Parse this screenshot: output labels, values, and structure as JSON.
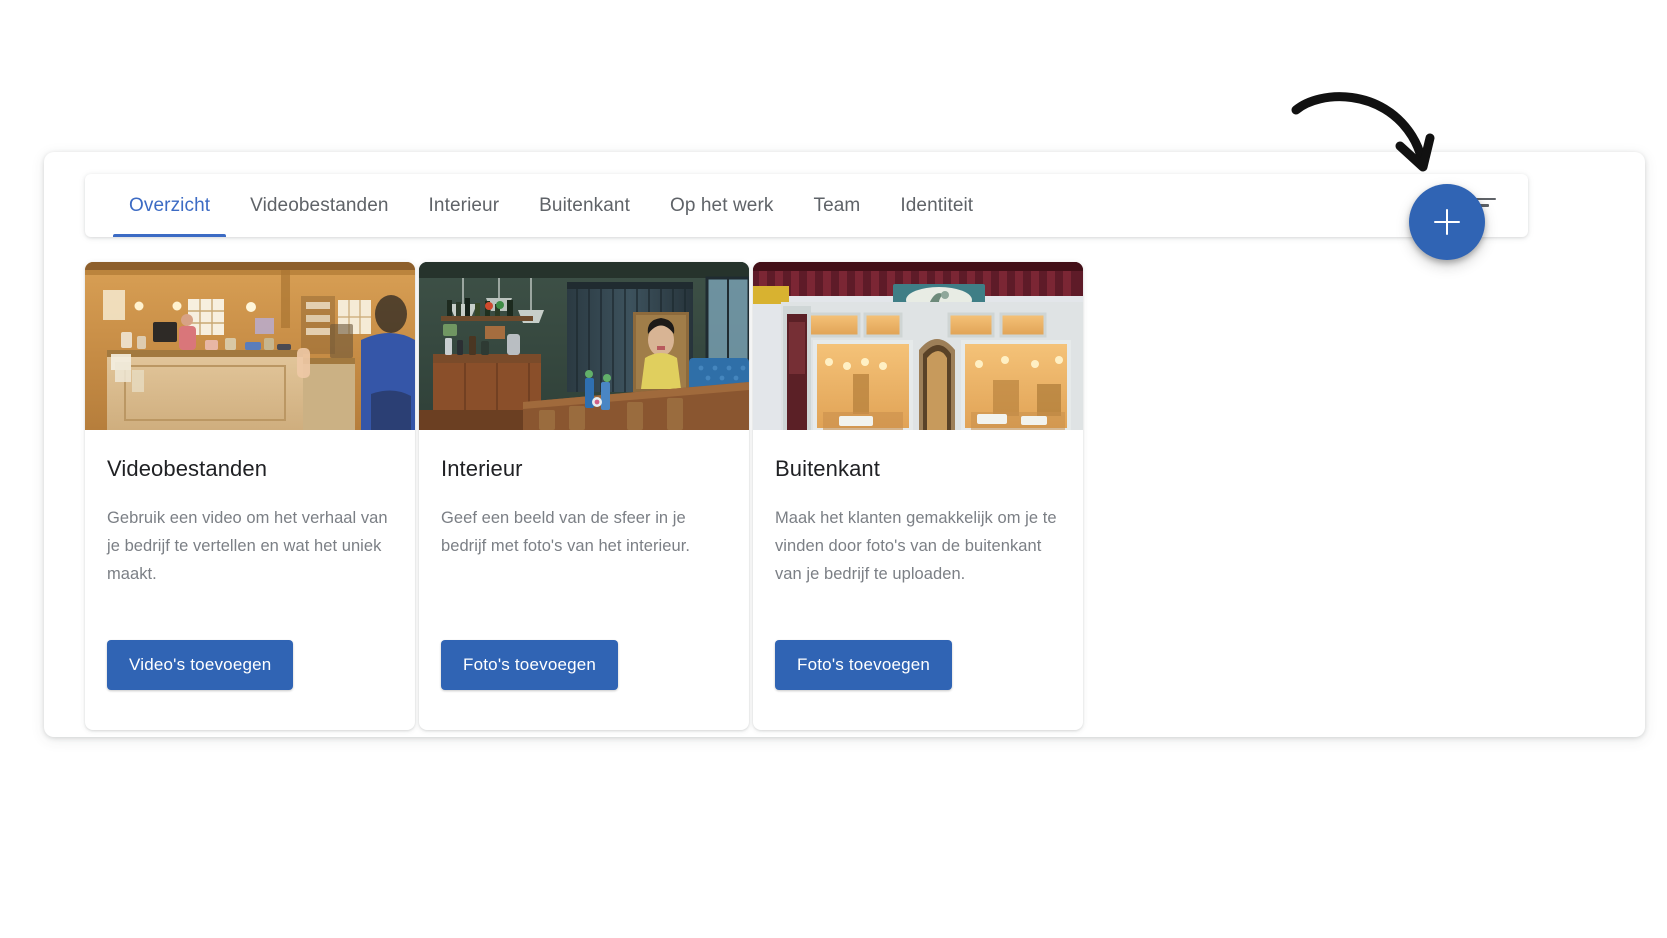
{
  "tabs": [
    {
      "label": "Overzicht",
      "active": true
    },
    {
      "label": "Videobestanden",
      "active": false
    },
    {
      "label": "Interieur",
      "active": false
    },
    {
      "label": "Buitenkant",
      "active": false
    },
    {
      "label": "Op het werk",
      "active": false
    },
    {
      "label": "Team",
      "active": false
    },
    {
      "label": "Identiteit",
      "active": false
    }
  ],
  "toolbar": {
    "sort_icon": "sort-list-icon",
    "fab_icon": "plus-icon",
    "fab_label": "+"
  },
  "annotation": {
    "arrow_icon": "curved-arrow-icon"
  },
  "cards": [
    {
      "title": "Videobestanden",
      "description": "Gebruik een video om het verhaal van je bedrijf te vertellen en wat het uniek maakt.",
      "button_label": "Video's toevoegen",
      "thumb_name": "shop-counter-interior-photo"
    },
    {
      "title": "Interieur",
      "description": "Geef een beeld van de sfeer in je bedrijf met foto's van het interieur.",
      "button_label": "Foto's toevoegen",
      "thumb_name": "restaurant-interior-photo"
    },
    {
      "title": "Buitenkant",
      "description": "Maak het klanten gemakkelijk om je te vinden door foto's van de buitenkant van je bedrijf te uploaden.",
      "button_label": "Foto's toevoegen",
      "thumb_name": "storefront-exterior-photo"
    }
  ],
  "colors": {
    "accent_blue": "#3064b4",
    "tab_active_blue": "#3c6bc4",
    "tab_inactive_gray": "#5f6368",
    "title_gray": "#202124",
    "body_gray": "#7b7f85",
    "panel_white": "#ffffff",
    "arrow_black": "#111111"
  }
}
